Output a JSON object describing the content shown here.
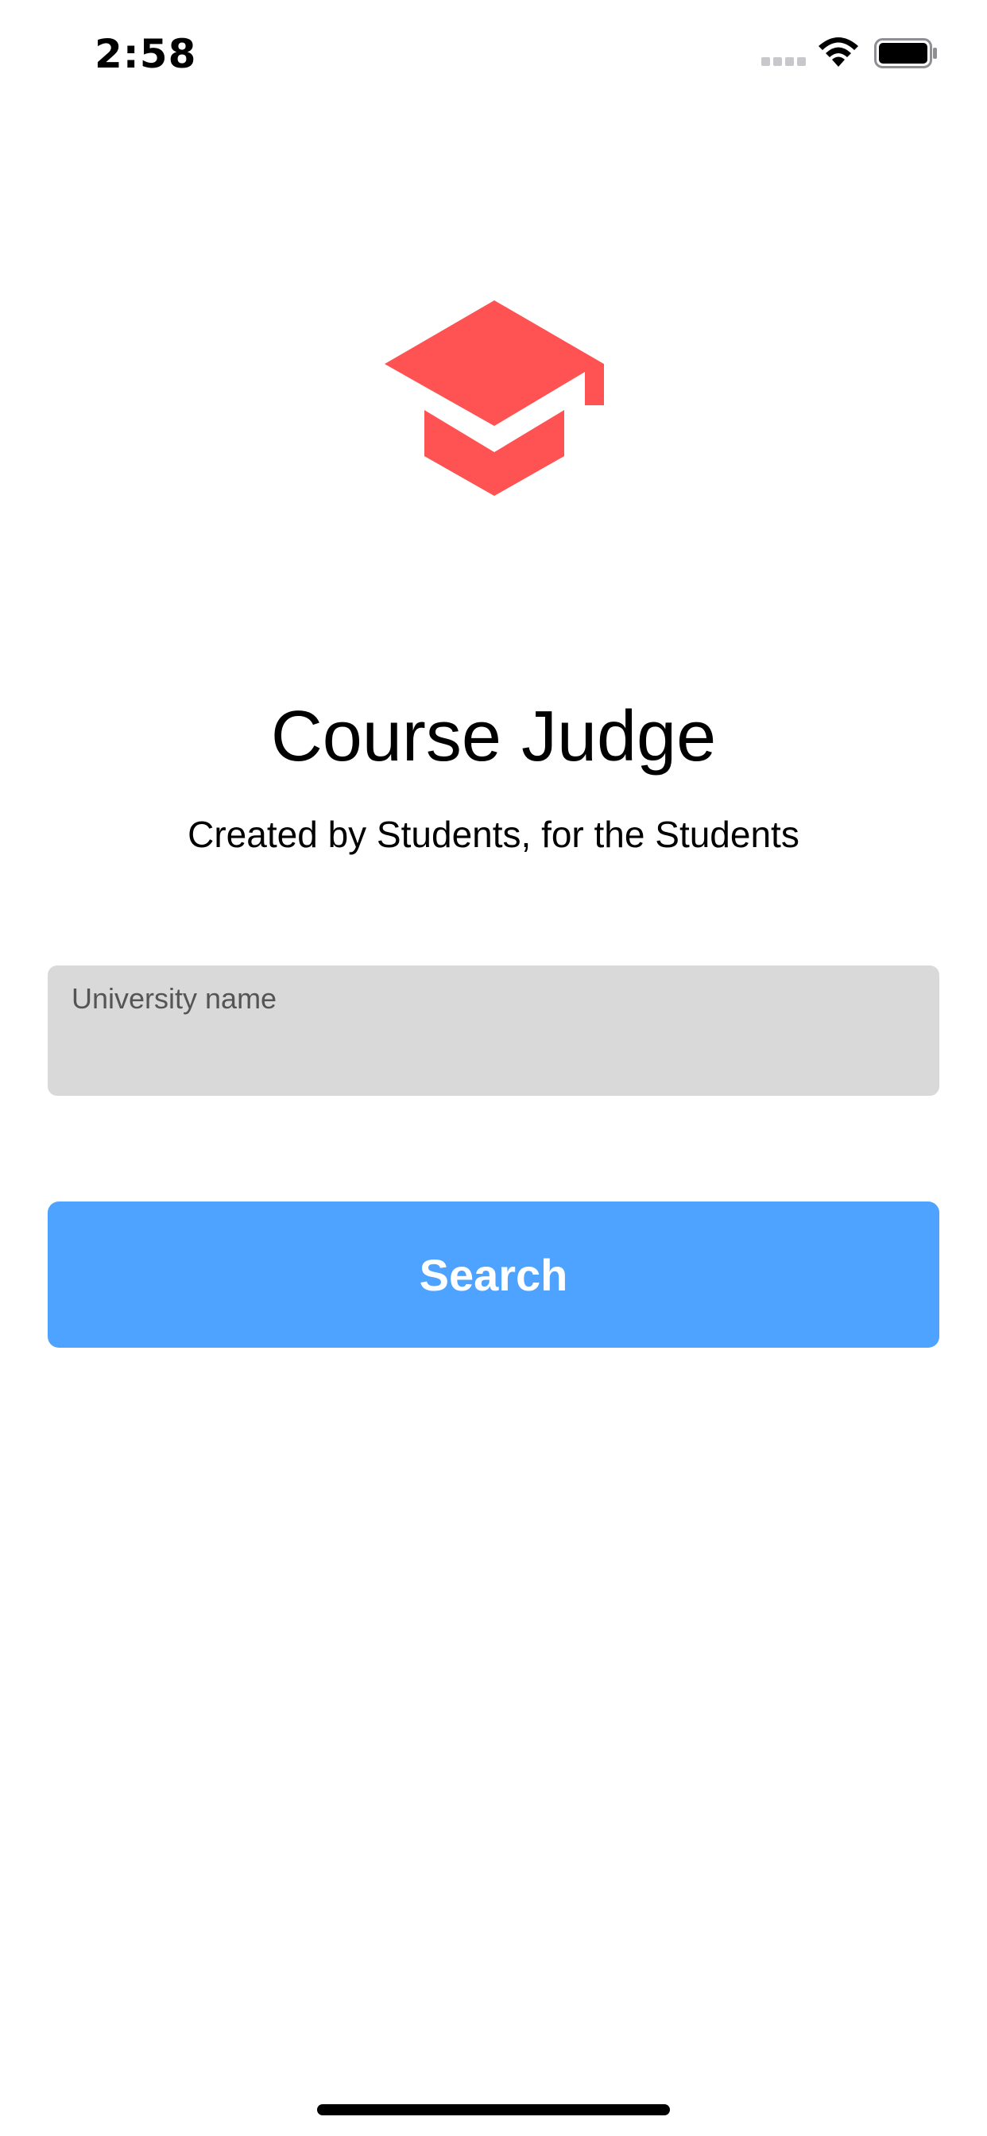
{
  "status_bar": {
    "time": "2:58",
    "icons": [
      "cellular-signal-icon",
      "wifi-icon",
      "battery-icon"
    ]
  },
  "logo": {
    "icon": "graduation-cap-icon",
    "color": "#ff5252"
  },
  "header": {
    "title": "Course Judge",
    "subtitle": "Created by Students, for the Students"
  },
  "search": {
    "placeholder": "University name",
    "value": "",
    "field_color": "#d9d9d9"
  },
  "actions": {
    "search_label": "Search",
    "button_color": "#4da3ff"
  }
}
